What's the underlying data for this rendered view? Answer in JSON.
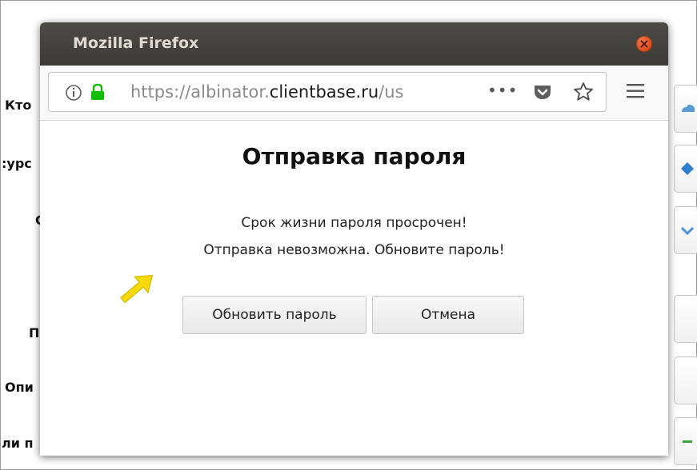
{
  "background": {
    "labels": [
      "Кто",
      ":урс",
      "С",
      "П",
      "Опи",
      "ли п"
    ]
  },
  "window": {
    "title": "Mozilla Firefox"
  },
  "urlbar": {
    "url_prefix": "https://albinator.",
    "url_domain": "clientbase.ru",
    "url_suffix": "/us",
    "more_label": "•••"
  },
  "dialog": {
    "title": "Отправка пароля",
    "message_line1": "Срок жизни пароля просрочен!",
    "message_line2": "Отправка невозможна. Обновите пароль!",
    "update_button": "Обновить пароль",
    "cancel_button": "Отмена"
  },
  "colors": {
    "titlebar": "#3c3b37",
    "close": "#dd4814",
    "lock": "#12bc00",
    "arrow": "#f5d90a"
  }
}
